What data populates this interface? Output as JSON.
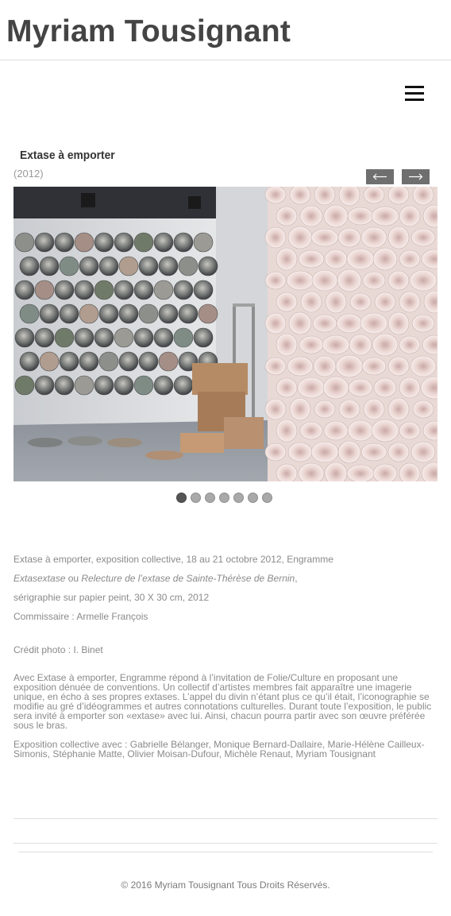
{
  "site": {
    "title": "Myriam Tousignant"
  },
  "header": {
    "menu_icon": "hamburger-menu-icon"
  },
  "project": {
    "title": "Extase à emporter",
    "year": "(2012)",
    "prev_icon": "arrow-left-icon",
    "next_icon": "arrow-right-icon"
  },
  "slider": {
    "slide_count": 7,
    "active_index": 0
  },
  "description": {
    "line1": "Extase à emporter, exposition collective, 18 au 21 octobre 2012, Engramme",
    "line2_italic_a": "Extasextase",
    "line2_middle": " ou ",
    "line2_italic_b": "Relecture de l’extase de Sainte-Thérèse de Bernin",
    "line2_end": ",",
    "line3": "sérigraphie sur papier peint, 30 X 30 cm, 2012",
    "line4": "Commissaire : Armelle François",
    "credit": "Crédit photo : I. Binet",
    "para1_l1": "Avec Extase à emporter, Engramme répond à l’invitation de Folie/Culture en proposant une",
    "para1_l2": "exposition dénuée de conventions. Un collectif d’artistes membres fait apparaître une imagerie",
    "para1_l3": "unique, en écho à ses propres extases. L’appel du divin n’étant plus ce qu’il était, l’iconographie se",
    "para1_l4": "modifie au gré d’idéogrammes et autres connotations culturelles. Durant toute l’exposition, le public",
    "para1_l5": "sera invité à emporter son «extase» avec lui. Ainsi, chacun pourra partir avec son œuvre préférée",
    "para1_l6": "sous le bras.",
    "para2_l1": "Exposition collective avec : Gabrielle Bélanger, Monique Bernard-Dallaire, Marie-Hélène Cailleux-",
    "para2_l2": "Simonis, Stéphanie Matte, Olivier Moisan-Dufour, Michèle Renaut, Myriam Tousignant"
  },
  "footer": {
    "copyright": "© 2016 Myriam Tousignant Tous Droits Réservés."
  }
}
